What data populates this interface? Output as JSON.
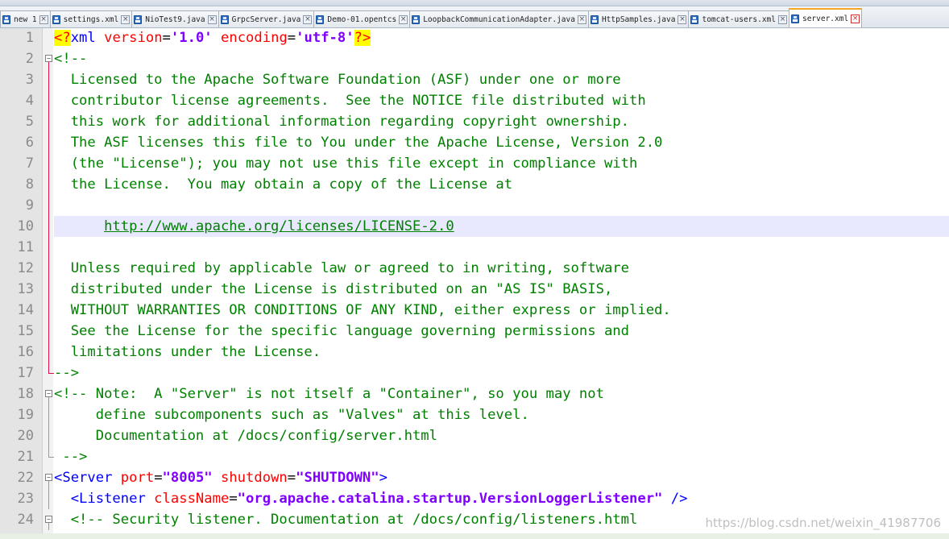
{
  "tabs": [
    {
      "name": "new 1",
      "active": false
    },
    {
      "name": "settings.xml",
      "active": false
    },
    {
      "name": "NioTest9.java",
      "active": false
    },
    {
      "name": "GrpcServer.java",
      "active": false
    },
    {
      "name": "Demo-01.opentcs",
      "active": false
    },
    {
      "name": "LoopbackCommunicationAdapter.java",
      "active": false
    },
    {
      "name": "HttpSamples.java",
      "active": false
    },
    {
      "name": "tomcat-users.xml",
      "active": false
    },
    {
      "name": "server.xml",
      "active": true
    }
  ],
  "close_glyph": "×",
  "lines": [
    {
      "n": "1",
      "tokens": [
        {
          "t": "<?",
          "c": "pi"
        },
        {
          "t": "xml ",
          "c": "tag"
        },
        {
          "t": "version",
          "c": "attr"
        },
        {
          "t": "=",
          "c": "q"
        },
        {
          "t": "'1.0'",
          "c": "val"
        },
        {
          "t": " encoding",
          "c": "attr"
        },
        {
          "t": "=",
          "c": "q"
        },
        {
          "t": "'utf-8'",
          "c": "val"
        },
        {
          "t": "?>",
          "c": "pi"
        }
      ]
    },
    {
      "n": "2",
      "tokens": [
        {
          "t": "<!--",
          "c": "cm"
        }
      ]
    },
    {
      "n": "3",
      "tokens": [
        {
          "t": "  Licensed to the Apache Software Foundation (ASF) under one or more",
          "c": "cm"
        }
      ]
    },
    {
      "n": "4",
      "tokens": [
        {
          "t": "  contributor license agreements.  See the NOTICE file distributed with",
          "c": "cm"
        }
      ]
    },
    {
      "n": "5",
      "tokens": [
        {
          "t": "  this work for additional information regarding copyright ownership.",
          "c": "cm"
        }
      ]
    },
    {
      "n": "6",
      "tokens": [
        {
          "t": "  The ASF licenses this file to You under the Apache License, Version 2.0",
          "c": "cm"
        }
      ]
    },
    {
      "n": "7",
      "tokens": [
        {
          "t": "  (the \"License\"); you may not use this file except in compliance with",
          "c": "cm"
        }
      ]
    },
    {
      "n": "8",
      "tokens": [
        {
          "t": "  the License.  You may obtain a copy of the License at",
          "c": "cm"
        }
      ]
    },
    {
      "n": "9",
      "tokens": []
    },
    {
      "n": "10",
      "tokens": [
        {
          "t": "      ",
          "c": "cm"
        },
        {
          "t": "http://www.apache.org/licenses/LICENSE-2.0",
          "c": "url"
        }
      ]
    },
    {
      "n": "11",
      "tokens": []
    },
    {
      "n": "12",
      "tokens": [
        {
          "t": "  Unless required by applicable law or agreed to in writing, software",
          "c": "cm"
        }
      ]
    },
    {
      "n": "13",
      "tokens": [
        {
          "t": "  distributed under the License is distributed on an \"AS IS\" BASIS,",
          "c": "cm"
        }
      ]
    },
    {
      "n": "14",
      "tokens": [
        {
          "t": "  WITHOUT WARRANTIES OR CONDITIONS OF ANY KIND, either express or implied.",
          "c": "cm"
        }
      ]
    },
    {
      "n": "15",
      "tokens": [
        {
          "t": "  See the License for the specific language governing permissions and",
          "c": "cm"
        }
      ]
    },
    {
      "n": "16",
      "tokens": [
        {
          "t": "  limitations under the License.",
          "c": "cm"
        }
      ]
    },
    {
      "n": "17",
      "tokens": [
        {
          "t": "-->",
          "c": "cm"
        }
      ]
    },
    {
      "n": "18",
      "tokens": [
        {
          "t": "<!-- Note:  A \"Server\" is not itself a \"Container\", so you may not",
          "c": "cm"
        }
      ]
    },
    {
      "n": "19",
      "tokens": [
        {
          "t": "     define subcomponents such as \"Valves\" at this level.",
          "c": "cm"
        }
      ]
    },
    {
      "n": "20",
      "tokens": [
        {
          "t": "     Documentation at /docs/config/server.html",
          "c": "cm"
        }
      ]
    },
    {
      "n": "21",
      "tokens": [
        {
          "t": " -->",
          "c": "cm"
        }
      ]
    },
    {
      "n": "22",
      "tokens": [
        {
          "t": "<Server",
          "c": "tag"
        },
        {
          "t": " port",
          "c": "attr"
        },
        {
          "t": "=",
          "c": "q"
        },
        {
          "t": "\"8005\"",
          "c": "val"
        },
        {
          "t": " shutdown",
          "c": "attr"
        },
        {
          "t": "=",
          "c": "q"
        },
        {
          "t": "\"SHUTDOWN\"",
          "c": "val"
        },
        {
          "t": ">",
          "c": "tag"
        }
      ]
    },
    {
      "n": "23",
      "tokens": [
        {
          "t": "  <Listener",
          "c": "tag"
        },
        {
          "t": " className",
          "c": "attr"
        },
        {
          "t": "=",
          "c": "q"
        },
        {
          "t": "\"org.apache.catalina.startup.VersionLoggerListener\"",
          "c": "val"
        },
        {
          "t": " />",
          "c": "tag"
        }
      ]
    },
    {
      "n": "24",
      "tokens": [
        {
          "t": "  <!-- Security listener. Documentation at /docs/config/listeners.html",
          "c": "cm"
        }
      ]
    }
  ],
  "current_line": "10",
  "watermark": "https://blog.csdn.net/weixin_41987706"
}
